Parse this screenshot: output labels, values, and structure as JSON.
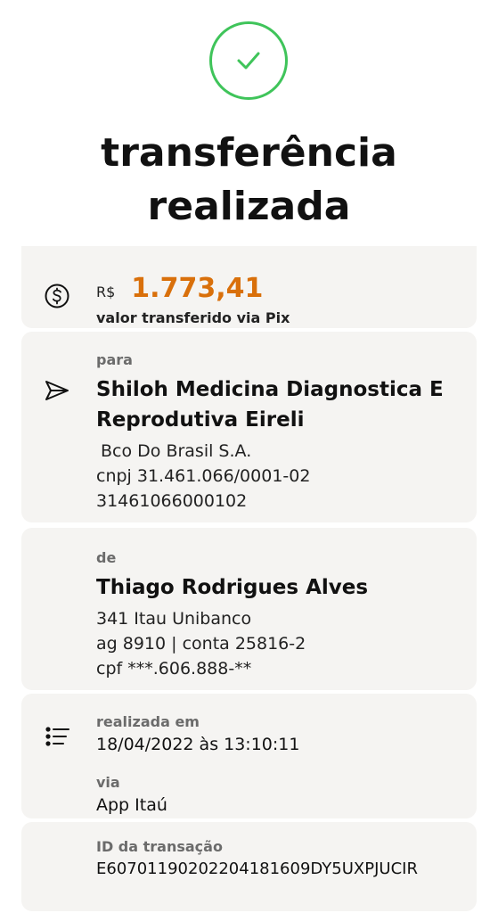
{
  "header": {
    "title_line1": "transferência",
    "title_line2": "realizada",
    "status_icon": "check-icon",
    "accent_color": "#3fc45a"
  },
  "amount": {
    "currency": "R$",
    "value": "1.773,41",
    "caption": "valor transferido via Pix",
    "icon": "dollar-circle-icon",
    "color": "#d9700b"
  },
  "recipient": {
    "label": "para",
    "name": "Shiloh Medicina Diagnostica E Reprodutiva Eireli",
    "bank": "Bco Do Brasil S.A.",
    "document": "cnpj 31.461.066/0001-02",
    "account": "31461066000102",
    "icon": "send-icon"
  },
  "sender": {
    "label": "de",
    "name": "Thiago Rodrigues Alves",
    "bank": "341 Itau Unibanco",
    "account": "ag 8910 | conta 25816-2",
    "document": "cpf ***.606.888-**"
  },
  "details": {
    "icon": "list-icon",
    "date_label": "realizada em",
    "date_value": "18/04/2022 às 13:10:11",
    "channel_label": "via",
    "channel_value": "App Itaú",
    "id_label": "ID da transação",
    "id_value": "E60701190202204181609DY5UXPJUCIR"
  }
}
